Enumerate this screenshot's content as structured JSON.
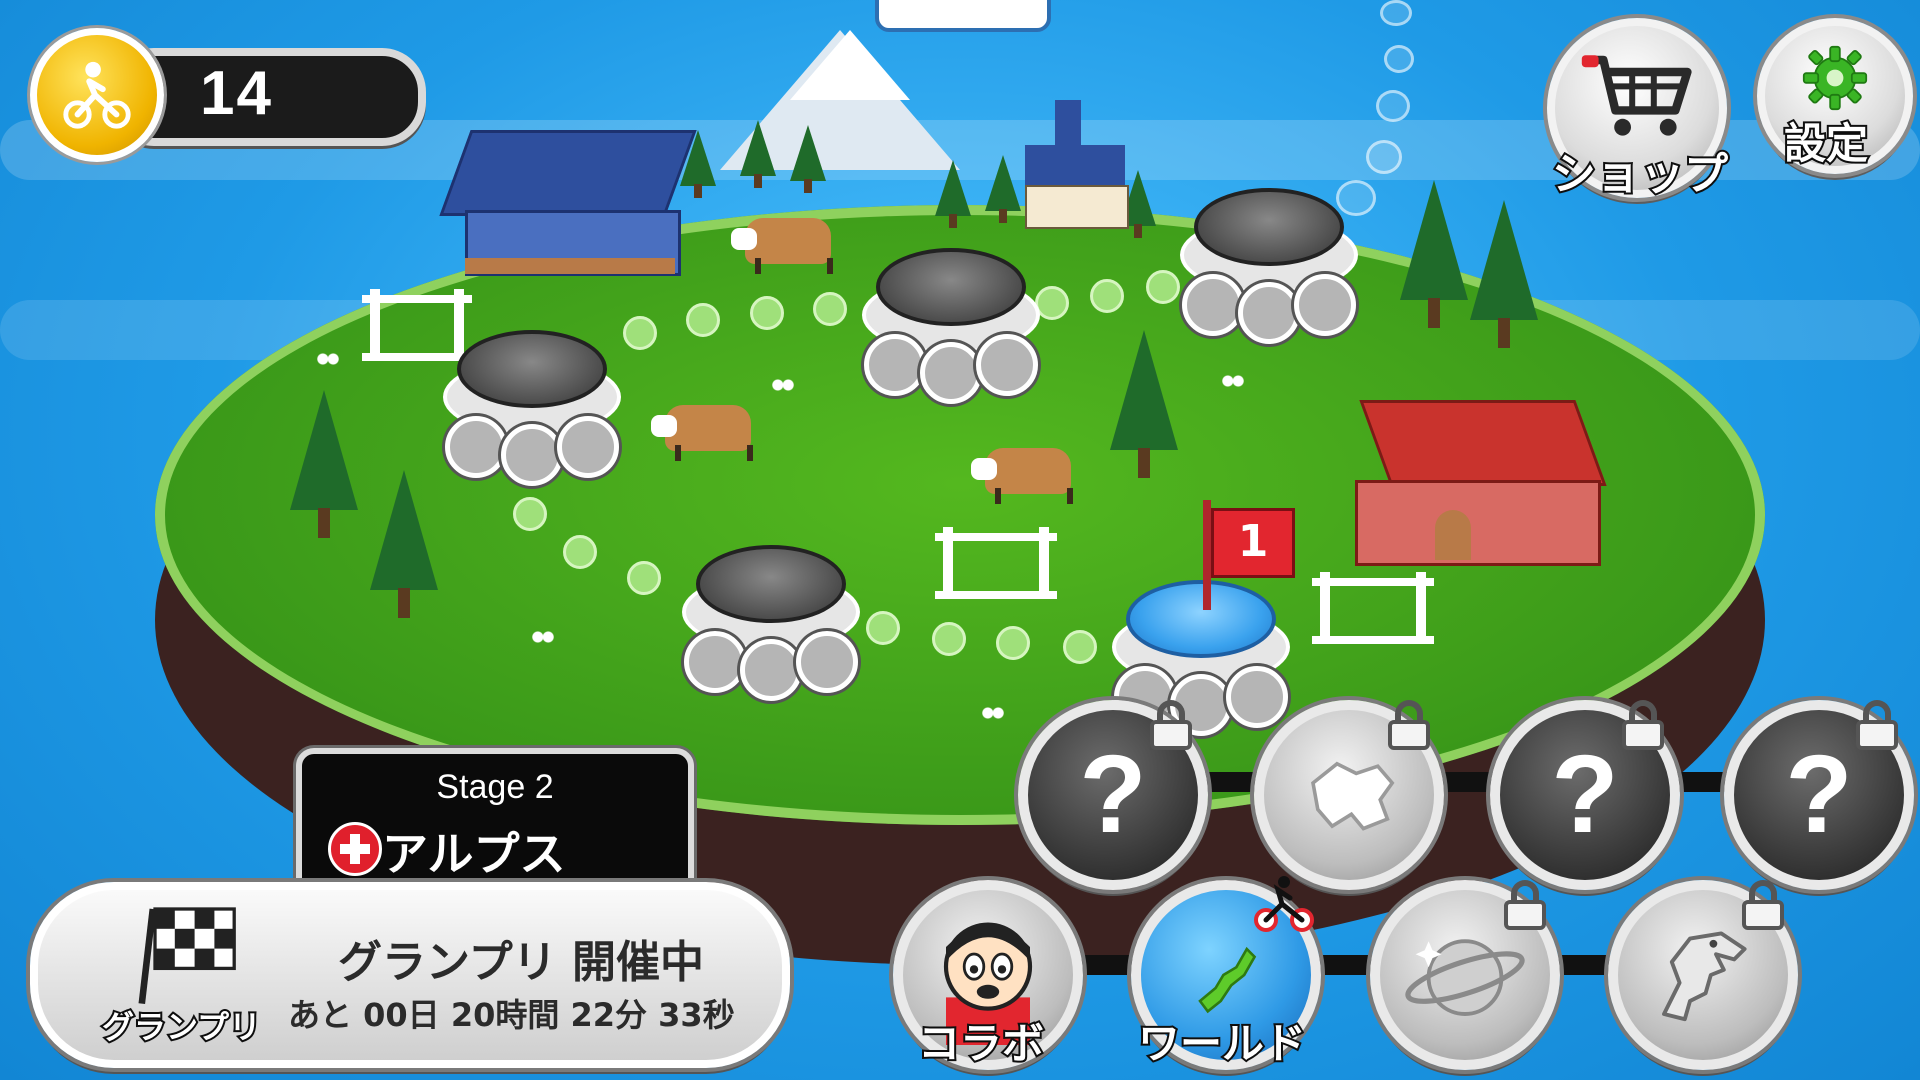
{
  "hud": {
    "coin_count": "14",
    "shop_label": "ショップ",
    "settings_label": "設定"
  },
  "map": {
    "current_flag_number": "1",
    "stage_panel": {
      "stage_text": "Stage 2",
      "stage_name": "アルプス"
    }
  },
  "grand_prix": {
    "label": "グランプリ",
    "title": "グランプリ 開催中",
    "timer": "あと 00日 20時間 22分 33秒"
  },
  "world_select": {
    "locked_symbol": "?",
    "collab_label": "コラボ",
    "world_label": "ワールド"
  },
  "colors": {
    "sky": "#1f9ae6",
    "grass": "#3e9d1a",
    "flag_red": "#e2262f",
    "coin_gold": "#f0b400"
  }
}
